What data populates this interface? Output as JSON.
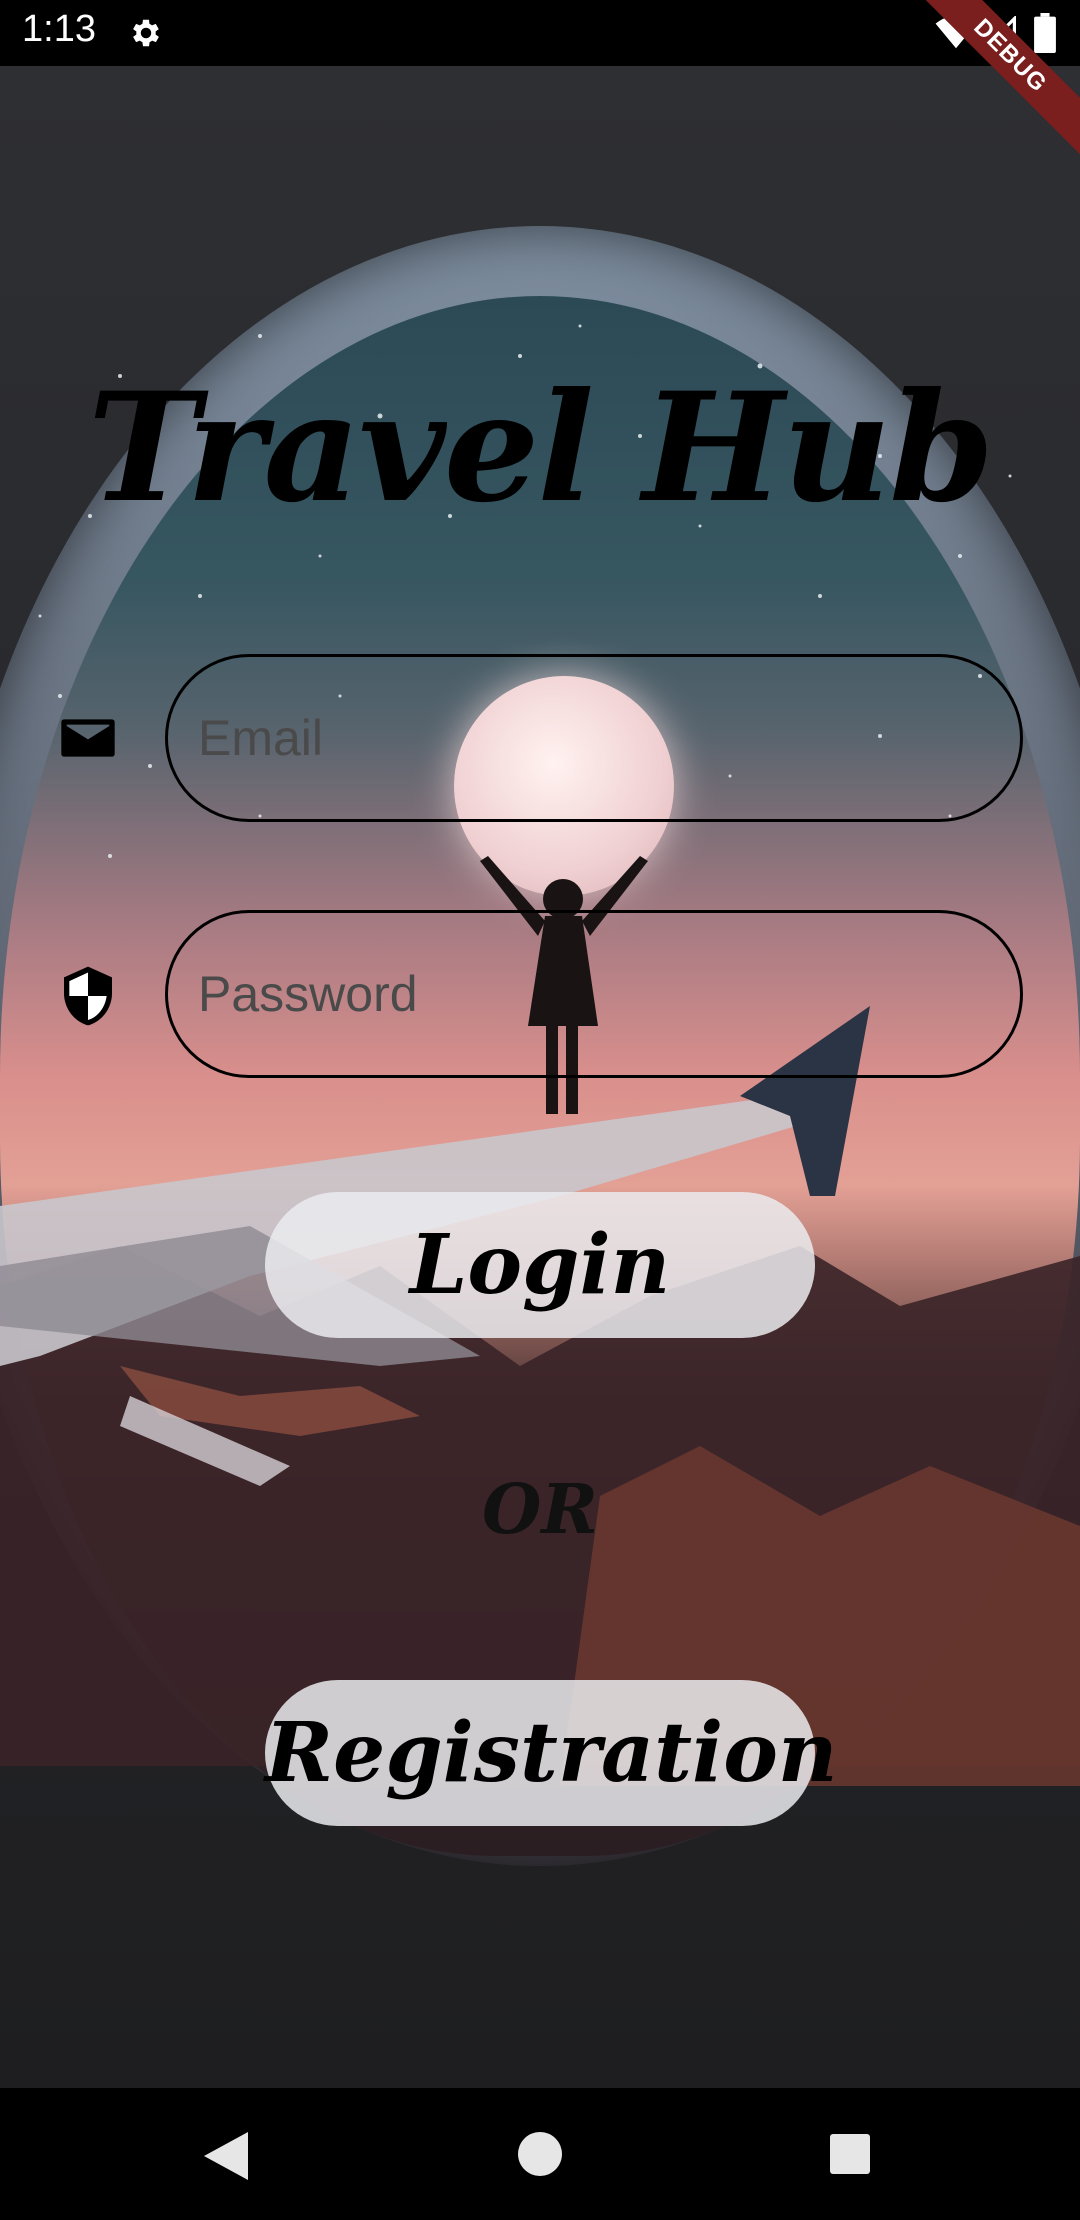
{
  "status_bar": {
    "time": "1:13",
    "debug_label": "DEBUG"
  },
  "app": {
    "title": "Travel Hub"
  },
  "form": {
    "email_placeholder": "Email",
    "email_value": "",
    "password_placeholder": "Password",
    "password_value": ""
  },
  "buttons": {
    "login": "Login",
    "or_label": "OR",
    "registration": "Registration"
  },
  "icons": {
    "email": "mail-icon",
    "password": "shield-icon",
    "settings": "gear-icon",
    "wifi": "wifi-icon",
    "signal": "signal-icon",
    "battery": "battery-icon",
    "back": "back-triangle-icon",
    "home": "home-circle-icon",
    "recents": "recents-square-icon"
  },
  "colors": {
    "button_bg": "#EBEBEE",
    "text": "#000000",
    "debug_ribbon": "#7B1E1E"
  }
}
